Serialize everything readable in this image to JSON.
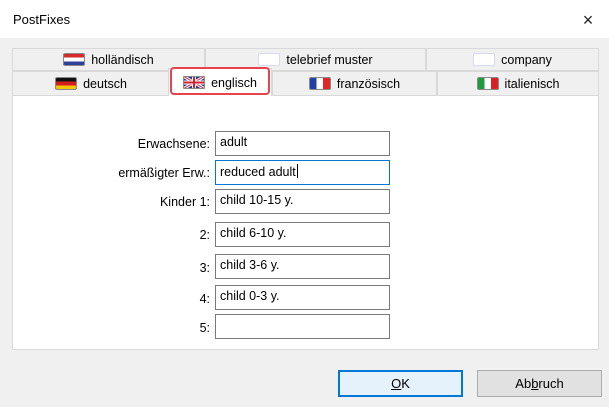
{
  "window": {
    "title": "PostFixes",
    "close_glyph": "×"
  },
  "tabs": {
    "row1": [
      {
        "label": "holländisch",
        "flag": "nl-flag-icon"
      },
      {
        "label": "telebrief muster",
        "flag": "blank-flag-icon"
      },
      {
        "label": "company",
        "flag": "blank-flag-icon"
      }
    ],
    "row2": [
      {
        "label": "deutsch",
        "flag": "de-flag-icon"
      },
      {
        "label": "englisch",
        "flag": "gb-flag-icon",
        "active": true
      },
      {
        "label": "französisch",
        "flag": "fr-flag-icon"
      },
      {
        "label": "italienisch",
        "flag": "it-flag-icon"
      }
    ]
  },
  "form": {
    "rows": [
      {
        "label": "Erwachsene:",
        "value": "adult"
      },
      {
        "label": "ermäßigter Erw.:",
        "value": "reduced adult",
        "focused": true
      },
      {
        "label": "Kinder 1:",
        "value": "child 10-15 y."
      },
      {
        "label": "2:",
        "value": "child 6-10 y."
      },
      {
        "label": "3:",
        "value": "child 3-6 y."
      },
      {
        "label": "4:",
        "value": "child 0-3 y."
      },
      {
        "label": "5:",
        "value": ""
      }
    ]
  },
  "buttons": {
    "ok_pre": "",
    "ok_mnemonic": "O",
    "ok_post": "K",
    "cancel_pre": "Ab",
    "cancel_mnemonic": "b",
    "cancel_post": "ruch"
  },
  "colors": {
    "highlight": "#e8424f",
    "focus": "#0078d7"
  }
}
